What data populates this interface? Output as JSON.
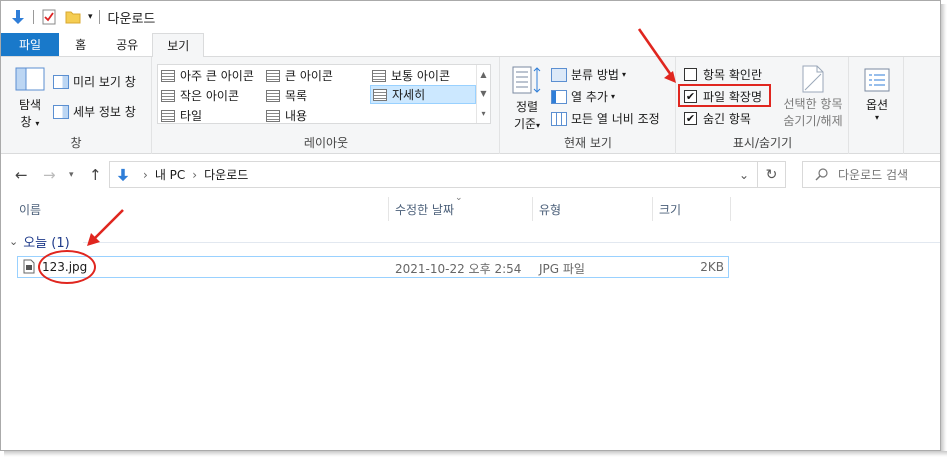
{
  "window": {
    "title": "다운로드"
  },
  "tabs": [
    {
      "label": "파일"
    },
    {
      "label": "홈"
    },
    {
      "label": "공유"
    },
    {
      "label": "보기"
    }
  ],
  "ribbon": {
    "pane": {
      "nav_pane_label_line1": "탐색",
      "nav_pane_label_line2": "창",
      "preview_pane": "미리 보기 창",
      "details_pane": "세부 정보 창",
      "group_label": "창"
    },
    "layout": {
      "items": [
        {
          "label": "아주 큰 아이콘"
        },
        {
          "label": "큰 아이콘"
        },
        {
          "label": "보통 아이콘"
        },
        {
          "label": "작은 아이콘"
        },
        {
          "label": "목록"
        },
        {
          "label": "자세히"
        },
        {
          "label": "타일"
        },
        {
          "label": "내용"
        }
      ],
      "selected": "자세히",
      "group_label": "레이아웃"
    },
    "current_view": {
      "sort_label_line1": "정렬",
      "sort_label_line2": "기준",
      "group_by": "분류 방법",
      "add_column": "열 추가",
      "fit_columns": "모든 열 너비 조정",
      "group_label": "현재 보기"
    },
    "show_hide": {
      "item_checkboxes": {
        "label": "항목 확인란",
        "checked": false
      },
      "file_extensions": {
        "label": "파일 확장명",
        "checked": true
      },
      "hidden_items": {
        "label": "숨긴 항목",
        "checked": true
      },
      "hide_selected_line1": "선택한 항목",
      "hide_selected_line2": "숨기기/해제",
      "group_label": "표시/숨기기"
    },
    "options": {
      "label": "옵션"
    }
  },
  "address": {
    "crumbs": [
      "내 PC",
      "다운로드"
    ],
    "search_placeholder": "다운로드 검색"
  },
  "columns": [
    {
      "label": "이름"
    },
    {
      "label": "수정한 날짜"
    },
    {
      "label": "유형"
    },
    {
      "label": "크기"
    }
  ],
  "group": {
    "label": "오늘 (1)"
  },
  "files": [
    {
      "name": "123.jpg",
      "modified": "2021-10-22 오후 2:54",
      "type": "JPG 파일",
      "size": "2KB"
    }
  ],
  "colors": {
    "accent": "#1979ca",
    "annotation": "#e0261f",
    "selection_bg": "#cce8ff"
  },
  "icons": [
    "down-arrow-icon",
    "properties-icon",
    "folder-icon",
    "back-icon",
    "forward-icon",
    "up-icon",
    "refresh-icon",
    "search-icon",
    "file-icon"
  ]
}
